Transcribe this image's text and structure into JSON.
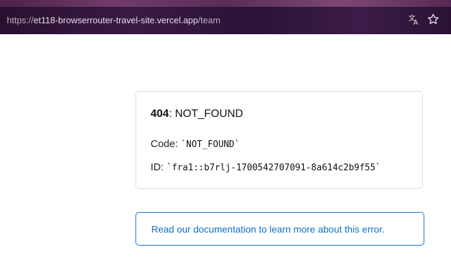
{
  "browser": {
    "url_scheme": "https://",
    "url_host": "et118-browserrouter-travel-site.vercel.app",
    "url_path": "/team",
    "translate_icon": "translate-icon",
    "bookmark_icon": "star-icon"
  },
  "error": {
    "status_code": "404",
    "status_text": ": NOT_FOUND",
    "code_label": "Code: ",
    "code_value": "`NOT_FOUND`",
    "id_label": "ID: ",
    "id_value": "`fra1::b7rlj-1700542707091-8a614c2b9f55`"
  },
  "docs": {
    "link_text": "Read our documentation to learn more about this error."
  }
}
